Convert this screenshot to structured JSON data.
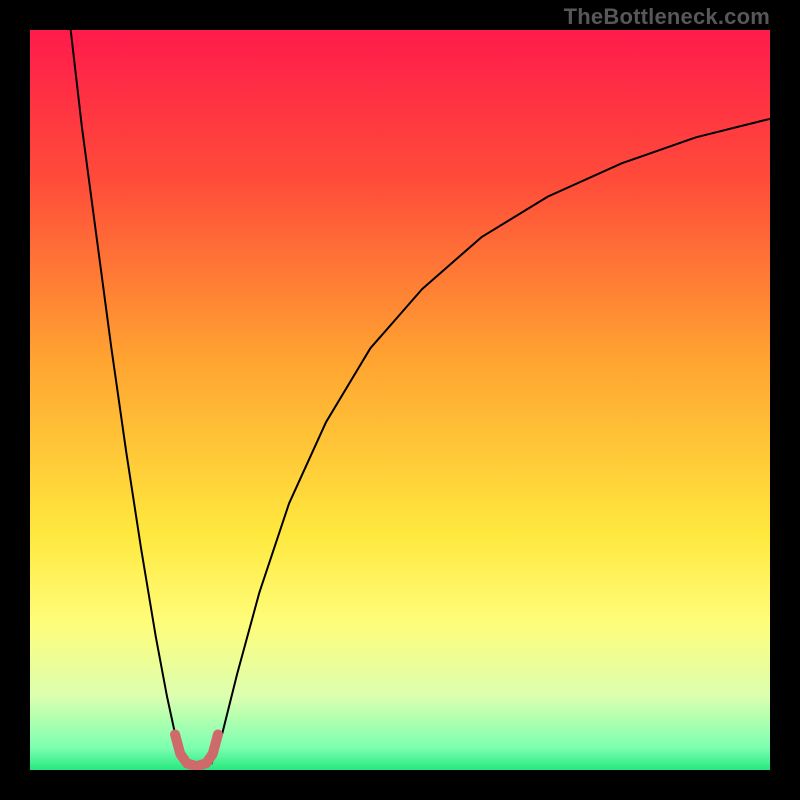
{
  "attribution": "TheBottleneck.com",
  "chart_data": {
    "type": "line",
    "title": "",
    "xlabel": "",
    "ylabel": "",
    "xlim": [
      0,
      100
    ],
    "ylim": [
      0,
      100
    ],
    "background_gradient": {
      "stops": [
        {
          "offset": 0,
          "color": "#ff1b4b"
        },
        {
          "offset": 20,
          "color": "#ff4b3a"
        },
        {
          "offset": 45,
          "color": "#ffa531"
        },
        {
          "offset": 68,
          "color": "#ffe83e"
        },
        {
          "offset": 80,
          "color": "#fffd7a"
        },
        {
          "offset": 90,
          "color": "#dcffb0"
        },
        {
          "offset": 97,
          "color": "#7cffb0"
        },
        {
          "offset": 100,
          "color": "#27e87f"
        }
      ]
    },
    "series": [
      {
        "name": "curve-left",
        "color": "#000000",
        "width": 2,
        "x": [
          5.5,
          7,
          9,
          11,
          13,
          15,
          17,
          18.5,
          19.8,
          20.8
        ],
        "y": [
          100,
          87,
          72,
          57,
          43,
          30,
          18,
          10,
          4,
          0.8
        ]
      },
      {
        "name": "curve-right",
        "color": "#000000",
        "width": 2,
        "x": [
          24.5,
          26,
          28,
          31,
          35,
          40,
          46,
          53,
          61,
          70,
          80,
          90,
          100
        ],
        "y": [
          0.8,
          5,
          13,
          24,
          36,
          47,
          57,
          65,
          72,
          77.5,
          82,
          85.5,
          88
        ]
      },
      {
        "name": "highlight-u",
        "color": "#cf6a6a",
        "width": 10,
        "linecap": "round",
        "x": [
          19.6,
          20.3,
          21.2,
          22.5,
          23.8,
          24.7,
          25.4
        ],
        "y": [
          4.8,
          2.2,
          0.9,
          0.5,
          0.9,
          2.2,
          4.8
        ]
      }
    ]
  }
}
